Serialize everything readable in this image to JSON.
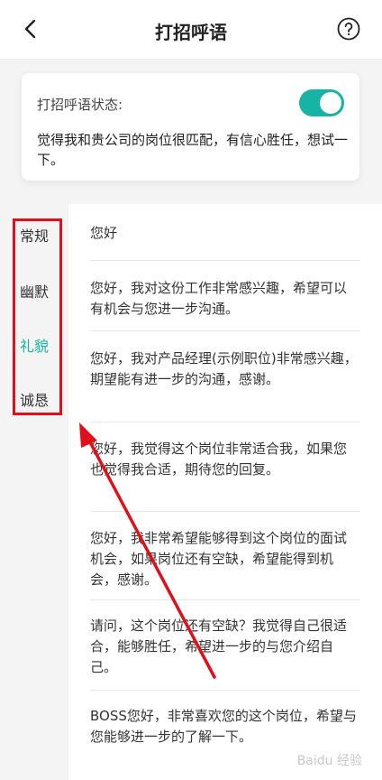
{
  "header": {
    "title": "打招呼语",
    "back_icon": "chevron-left-icon",
    "help_icon": "question-circle-icon"
  },
  "status": {
    "label": "打招呼语状态:",
    "enabled": true,
    "text": "觉得我和贵公司的岗位很匹配，有信心胜任，想试一下。"
  },
  "categories": [
    {
      "label": "常规"
    },
    {
      "label": "幽默"
    },
    {
      "label": "礼貌"
    },
    {
      "label": "诚恳"
    }
  ],
  "selected_category": "礼貌",
  "greetings": [
    {
      "text": "您好"
    },
    {
      "text": "您好，我对这份工作非常感兴趣，希望可以有机会与您进一步沟通。"
    },
    {
      "text": "您好，我对产品经理(示例职位)非常感兴趣，期望能有进一步的沟通，感谢。"
    },
    {
      "text": "您好，我觉得这个岗位非常适合我，如果您也觉得我合适，期待您的回复。"
    },
    {
      "text": "您好，我非常希望能够得到这个岗位的面试机会，如果岗位还有空缺，希望能得到机会，感谢。"
    },
    {
      "text": "请问，这个岗位还有空缺？我觉得自己很适合，能够胜任，希望进一步的与您介绍自己。"
    },
    {
      "text": "BOSS您好，非常喜欢您的这个岗位，希望与您能够进一步的了解一下。"
    }
  ],
  "annotation_colors": {
    "box": "#e0101a",
    "accent": "#17b3a4"
  },
  "watermark": "Baidu 经验"
}
